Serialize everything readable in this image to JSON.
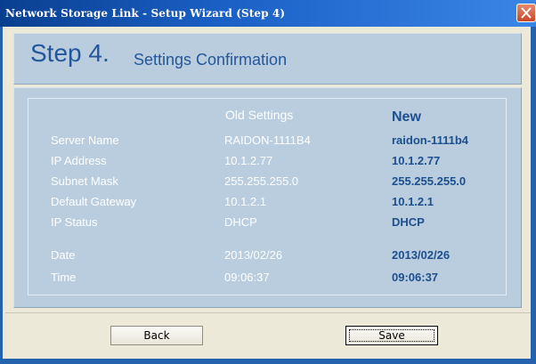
{
  "window": {
    "title": "Network Storage Link - Setup Wizard (Step 4)"
  },
  "header": {
    "step": "Step 4.",
    "title": "Settings Confirmation"
  },
  "settings": {
    "old_header": "Old Settings",
    "new_header": "New",
    "rows": [
      {
        "label": "Server Name",
        "old": "RAIDON-1111B4",
        "new": "raidon-1111b4"
      },
      {
        "label": "IP Address",
        "old": "10.1.2.77",
        "new": "10.1.2.77"
      },
      {
        "label": "Subnet Mask",
        "old": "255.255.255.0",
        "new": "255.255.255.0"
      },
      {
        "label": "Default Gateway",
        "old": "10.1.2.1",
        "new": "10.1.2.1"
      },
      {
        "label": "IP Status",
        "old": "DHCP",
        "new": "DHCP"
      },
      {
        "label": "Date",
        "old": "2013/02/26",
        "new": "2013/02/26"
      },
      {
        "label": "Time",
        "old": "09:06:37",
        "new": "09:06:37"
      }
    ]
  },
  "buttons": {
    "back": "Back",
    "save": "Save"
  },
  "colors": {
    "title_bar": "#1a5fc4",
    "panel": "#b9cdde",
    "accent_text": "#1d4f8e",
    "client_bg": "#ece9d8"
  },
  "icons": {
    "close": "close-icon"
  }
}
